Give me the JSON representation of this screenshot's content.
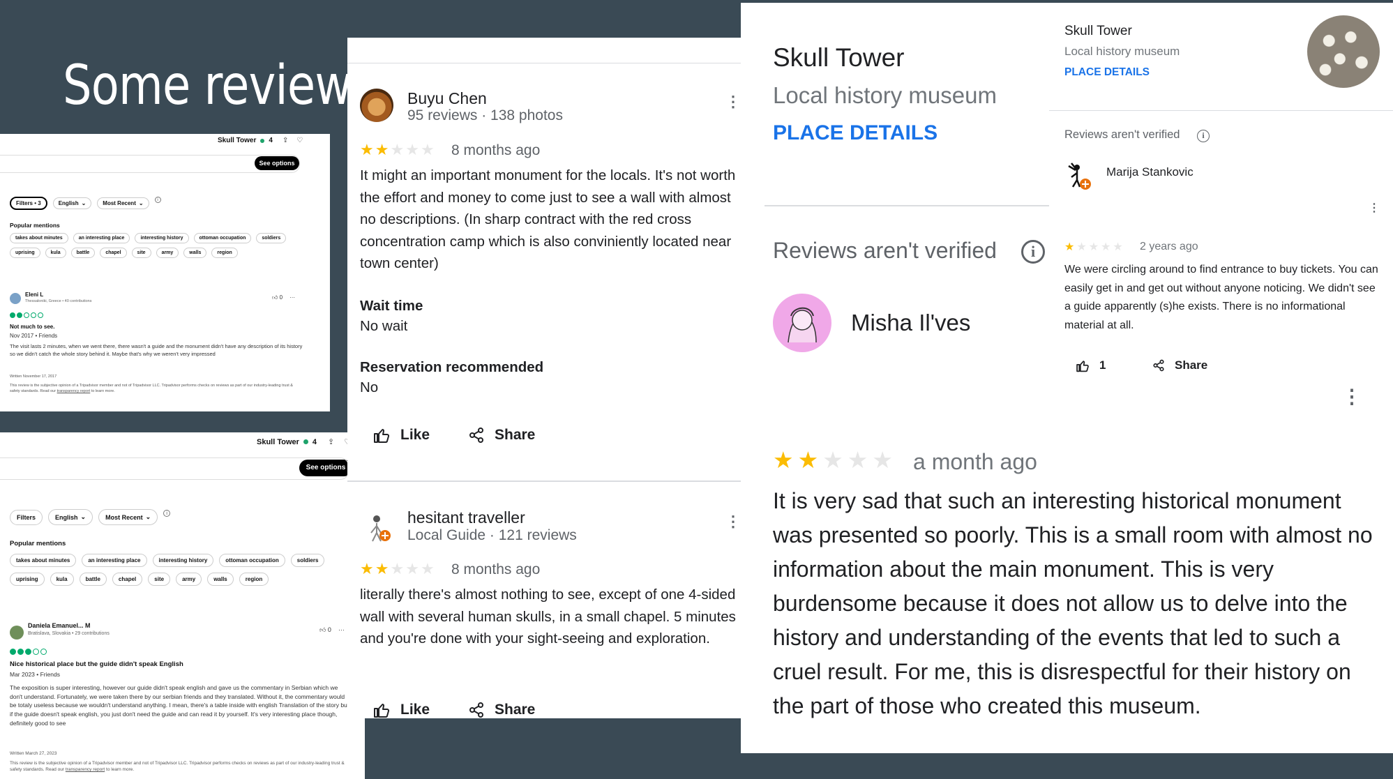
{
  "slide": {
    "title": "Some reviews"
  },
  "ta1": {
    "place": "Skull Tower",
    "rating": "4",
    "see_options": "See options",
    "filters": [
      "Filters • 3",
      "English",
      "Most Recent"
    ],
    "popular_label": "Popular mentions",
    "mentions": [
      "takes about minutes",
      "an interesting place",
      "interesting history",
      "ottoman occupation",
      "soldiers",
      "uprising",
      "kula",
      "battle",
      "chapel",
      "site",
      "army",
      "walls",
      "region"
    ],
    "review": {
      "name": "Eleni L",
      "sub": "Thessaloniki, Greece • 40 contributions",
      "likes": "0",
      "bubbles": 2,
      "title": "Not much to see.",
      "date": "Nov 2017 • Friends",
      "body": "The visit lasts 2 minutes, when we went there, there wasn't a guide and the monument didn't have any description of its history so we didn't catch the whole story behind it. Maybe that's why we weren't very impressed",
      "written": "Written November 17, 2017",
      "disclaimer": "This review is the subjective opinion of a Tripadvisor member and not of Tripadvisor LLC. Tripadvisor performs checks on reviews as part of our industry-leading trust & safety standards. Read our",
      "disclaimer_link": "transparency report",
      "disclaimer_end": "to learn more."
    }
  },
  "ta2": {
    "place": "Skull Tower",
    "rating": "4",
    "see_options": "See options",
    "filters": [
      "Filters",
      "English",
      "Most Recent"
    ],
    "popular_label": "Popular mentions",
    "mentions": [
      "takes about minutes",
      "an interesting place",
      "interesting history",
      "ottoman occupation",
      "soldiers",
      "uprising",
      "kula",
      "battle",
      "chapel",
      "site",
      "army",
      "walls",
      "region"
    ],
    "review": {
      "name": "Daniela Emanuel... M",
      "sub": "Bratislava, Slovakia • 29 contributions",
      "likes": "0",
      "bubbles": 3,
      "title": "Nice historical place but the guide didn't speak English",
      "date": "Mar 2023 • Friends",
      "body": "The exposition is super interesting, however our guide didn't speak english and gave us the commentary in Serbian which we don't understand. Fortunately, we were taken there by our serbian friends and they translated. Without it, the commentary would be totaly useless because we wouldn't understand anything. I mean, there's a table inside with english Translation of the story but if the guide doesn't speak english, you just don't need the guide and can read it by yourself. It's very interesting place though, definitely good to see",
      "written": "Written March 27, 2023",
      "disclaimer": "This review is the subjective opinion of a Tripadvisor member and not of Tripadvisor LLC. Tripadvisor performs checks on reviews as part of our industry-leading trust & safety standards. Read our",
      "disclaimer_link": "transparency report",
      "disclaimer_end": "to learn more."
    }
  },
  "gm_mid": {
    "review1": {
      "name": "Buyu Chen",
      "sub": "95 reviews · 138 photos",
      "stars": 2,
      "time": "8 months ago",
      "body": "It might an important monument for the locals. It's not worth the effort and money to come just to see a wall with almost no descriptions. (In sharp contract with the red cross concentration camp which is also conviniently located near town center)",
      "wait_label": "Wait time",
      "wait_value": "No wait",
      "res_label": "Reservation recommended",
      "res_value": "No",
      "like": "Like",
      "share": "Share"
    },
    "review2": {
      "name": "hesitant traveller",
      "sub": "Local Guide · 121 reviews",
      "stars": 2,
      "time": "8 months ago",
      "body": "literally there's almost nothing to see, except of one 4-sided wall with several human skulls, in a small chapel. 5 minutes and you're done with your sight-seeing and exploration.",
      "like": "Like",
      "share": "Share"
    }
  },
  "gm_right": {
    "place": "Skull Tower",
    "category": "Local history museum",
    "details": "PLACE DETAILS",
    "not_verified": "Reviews aren't verified",
    "reviewer": "Misha Il'ves",
    "stars": 2,
    "time": "a month ago",
    "body": "It is very sad that such an interesting historical monument was presented so poorly. This is a small room with almost no information about the main monument. This is very burdensome because it does not allow us to delve into the history and understanding of the events that led to such a cruel result. For me, this is disrespectful for their history on the part of those who created this museum."
  },
  "gm_inset": {
    "place": "Skull Tower",
    "category": "Local history museum",
    "details": "PLACE DETAILS",
    "not_verified": "Reviews aren't verified",
    "reviewer": "Marija Stankovic",
    "stars": 1,
    "time": "2 years ago",
    "body": "We were circling around to find entrance to buy tickets. You can easily get in and get out without anyone noticing. We didn't see a guide apparently (s)he exists. There is no informational material at all.",
    "likes": "1",
    "share": "Share"
  },
  "colors": {
    "bg": "#3a4a55",
    "star": "#fbbc04",
    "link": "#1a73e8",
    "ta_green": "#00aa6c"
  },
  "icons": [
    "thumb-up-icon",
    "share-icon",
    "more-vert-icon",
    "info-icon",
    "heart-icon",
    "chevron-down-icon"
  ]
}
